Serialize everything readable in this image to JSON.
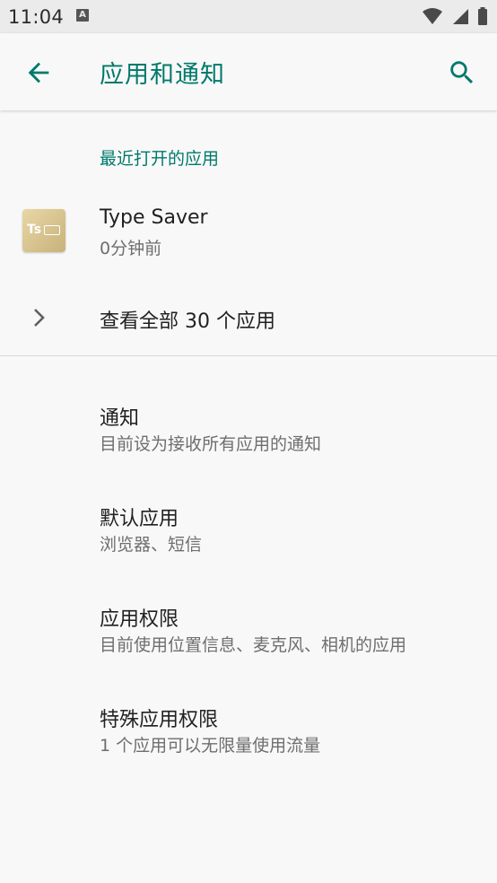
{
  "status_bar": {
    "time": "11:04",
    "notification_badge": "A"
  },
  "app_bar": {
    "title": "应用和通知",
    "back_icon": "arrow-back-icon",
    "search_icon": "search-icon"
  },
  "recent_apps": {
    "header": "最近打开的应用",
    "items": [
      {
        "name": "Type Saver",
        "time": "0分钟前",
        "icon_text": "Ts"
      }
    ],
    "see_all": "查看全部 30 个应用"
  },
  "settings": [
    {
      "title": "通知",
      "summary": "目前设为接收所有应用的通知"
    },
    {
      "title": "默认应用",
      "summary": "浏览器、短信"
    },
    {
      "title": "应用权限",
      "summary": "目前使用位置信息、麦克风、相机的应用"
    },
    {
      "title": "特殊应用权限",
      "summary": "1 个应用可以无限量使用流量"
    }
  ],
  "colors": {
    "accent": "#00796b",
    "background": "#f8f8f8",
    "status_bar": "#ebebeb"
  }
}
